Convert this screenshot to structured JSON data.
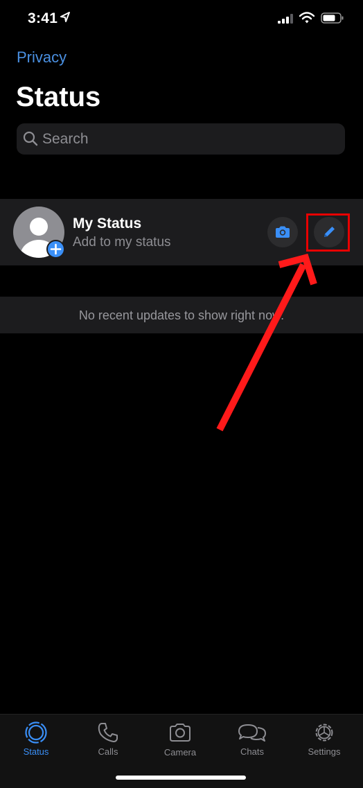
{
  "status_bar": {
    "time": "3:41"
  },
  "nav": {
    "privacy_label": "Privacy"
  },
  "header": {
    "title": "Status"
  },
  "search": {
    "placeholder": "Search"
  },
  "my_status": {
    "title": "My Status",
    "subtitle": "Add to my status"
  },
  "recent": {
    "empty_text": "No recent updates to show right now."
  },
  "tabs": [
    {
      "label": "Status",
      "icon": "status-icon",
      "active": true
    },
    {
      "label": "Calls",
      "icon": "phone-icon",
      "active": false
    },
    {
      "label": "Camera",
      "icon": "camera-icon",
      "active": false
    },
    {
      "label": "Chats",
      "icon": "chat-bubbles-icon",
      "active": false
    },
    {
      "label": "Settings",
      "icon": "gear-icon",
      "active": false
    }
  ],
  "colors": {
    "accent": "#3a8ff7",
    "link": "#4a90e2",
    "annotation": "#e80000",
    "background": "#000000",
    "row": "#1c1c1e"
  }
}
